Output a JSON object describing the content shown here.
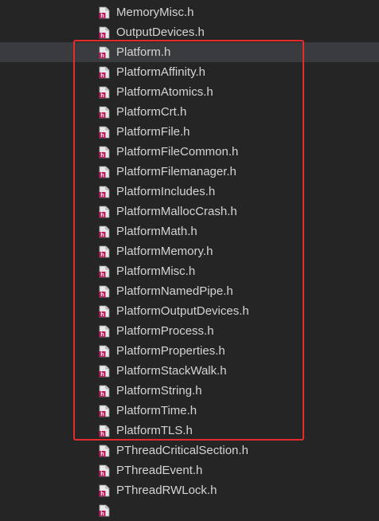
{
  "file_tree": {
    "items": [
      {
        "label": "MemoryMisc.h",
        "selected": false
      },
      {
        "label": "OutputDevices.h",
        "selected": false
      },
      {
        "label": "Platform.h",
        "selected": true
      },
      {
        "label": "PlatformAffinity.h",
        "selected": false
      },
      {
        "label": "PlatformAtomics.h",
        "selected": false
      },
      {
        "label": "PlatformCrt.h",
        "selected": false
      },
      {
        "label": "PlatformFile.h",
        "selected": false
      },
      {
        "label": "PlatformFileCommon.h",
        "selected": false
      },
      {
        "label": "PlatformFilemanager.h",
        "selected": false
      },
      {
        "label": "PlatformIncludes.h",
        "selected": false
      },
      {
        "label": "PlatformMallocCrash.h",
        "selected": false
      },
      {
        "label": "PlatformMath.h",
        "selected": false
      },
      {
        "label": "PlatformMemory.h",
        "selected": false
      },
      {
        "label": "PlatformMisc.h",
        "selected": false
      },
      {
        "label": "PlatformNamedPipe.h",
        "selected": false
      },
      {
        "label": "PlatformOutputDevices.h",
        "selected": false
      },
      {
        "label": "PlatformProcess.h",
        "selected": false
      },
      {
        "label": "PlatformProperties.h",
        "selected": false
      },
      {
        "label": "PlatformStackWalk.h",
        "selected": false
      },
      {
        "label": "PlatformString.h",
        "selected": false
      },
      {
        "label": "PlatformTime.h",
        "selected": false
      },
      {
        "label": "PlatformTLS.h",
        "selected": false
      },
      {
        "label": "PThreadCriticalSection.h",
        "selected": false
      },
      {
        "label": "PThreadEvent.h",
        "selected": false
      },
      {
        "label": "PThreadRWLock.h",
        "selected": false
      }
    ],
    "icon": "header-file-icon"
  },
  "colors": {
    "background": "#252526",
    "selected_row": "#3a3b3f",
    "text": "#d4d4d4",
    "annotation_box": "#e52b2b",
    "icon_accent": "#c2185b"
  }
}
